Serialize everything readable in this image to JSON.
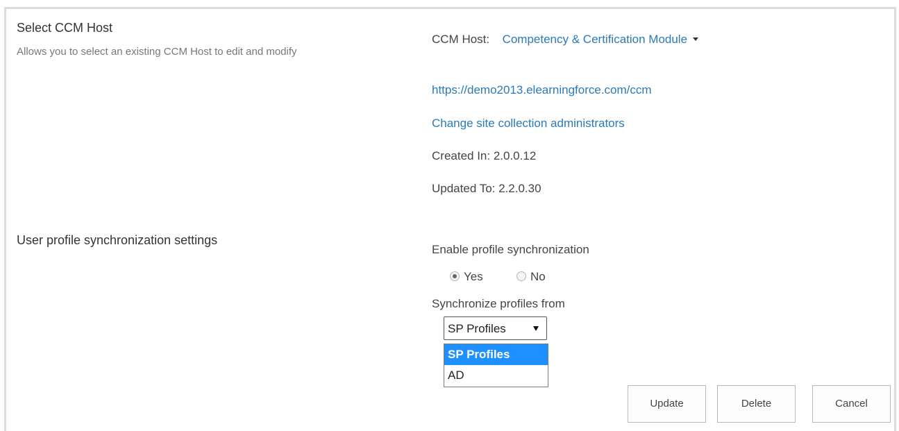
{
  "select_host_section": {
    "title": "Select CCM Host",
    "description": "Allows you to select an existing CCM Host to edit and modify",
    "host_label": "CCM Host:",
    "host_value": "Competency & Certification Module",
    "url": "https://demo2013.elearningforce.com/ccm",
    "change_admins_link": "Change site collection administrators",
    "created_in": "Created In: 2.0.0.12",
    "updated_to": "Updated To: 2.2.0.30"
  },
  "sync_section": {
    "title": "User profile synchronization settings",
    "enable_label": "Enable profile synchronization",
    "radio_options": [
      {
        "label": "Yes",
        "checked": true
      },
      {
        "label": "No",
        "checked": false
      }
    ],
    "sync_from_label": "Synchronize profiles from",
    "select_value": "SP Profiles",
    "select_options": [
      "SP Profiles",
      "AD"
    ],
    "highlighted_option": "SP Profiles"
  },
  "buttons": {
    "update": "Update",
    "delete": "Delete",
    "cancel": "Cancel"
  },
  "colors": {
    "link": "#2a7ab8",
    "selected_option_bg": "#1e90ff",
    "frame_border": "#dcdcdc"
  }
}
